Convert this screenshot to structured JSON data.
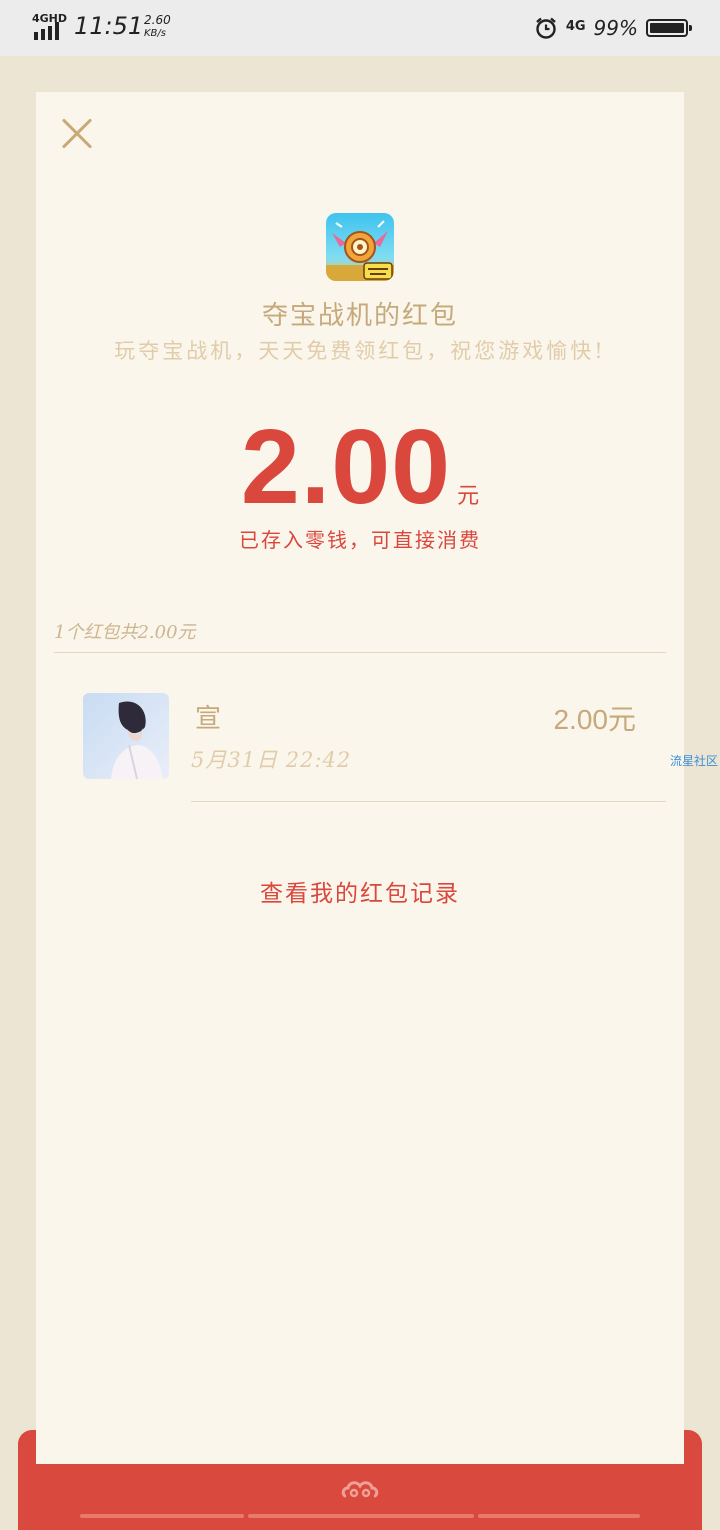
{
  "status_bar": {
    "network_type": "4GHD",
    "time": "11:51",
    "speed_value": "2.60",
    "speed_unit": "KB/s",
    "mobile_data": "4G",
    "battery_percent": "99%",
    "battery_level": 0.99
  },
  "header": {
    "close_icon": "close-icon",
    "app_logo": "game-logo-image",
    "title": "夺宝战机的红包",
    "subtitle": "玩夺宝战机，天天免费领红包，祝您游戏愉快!"
  },
  "amount": {
    "value": "2.00",
    "unit": "元",
    "note": "已存入零钱，可直接消费"
  },
  "summary": "1个红包共2.00元",
  "records": [
    {
      "name": "宣",
      "time": "5月31日  22:42",
      "amount": "2.00",
      "unit": "元"
    }
  ],
  "watermark": "流星社区",
  "link": "查看我的红包记录",
  "colors": {
    "accent_red": "#d9473d",
    "gold": "#c6a97a",
    "light_gold": "#e1ccaa",
    "card_bg": "#fbf6ec",
    "page_bg": "#ede5d3"
  }
}
